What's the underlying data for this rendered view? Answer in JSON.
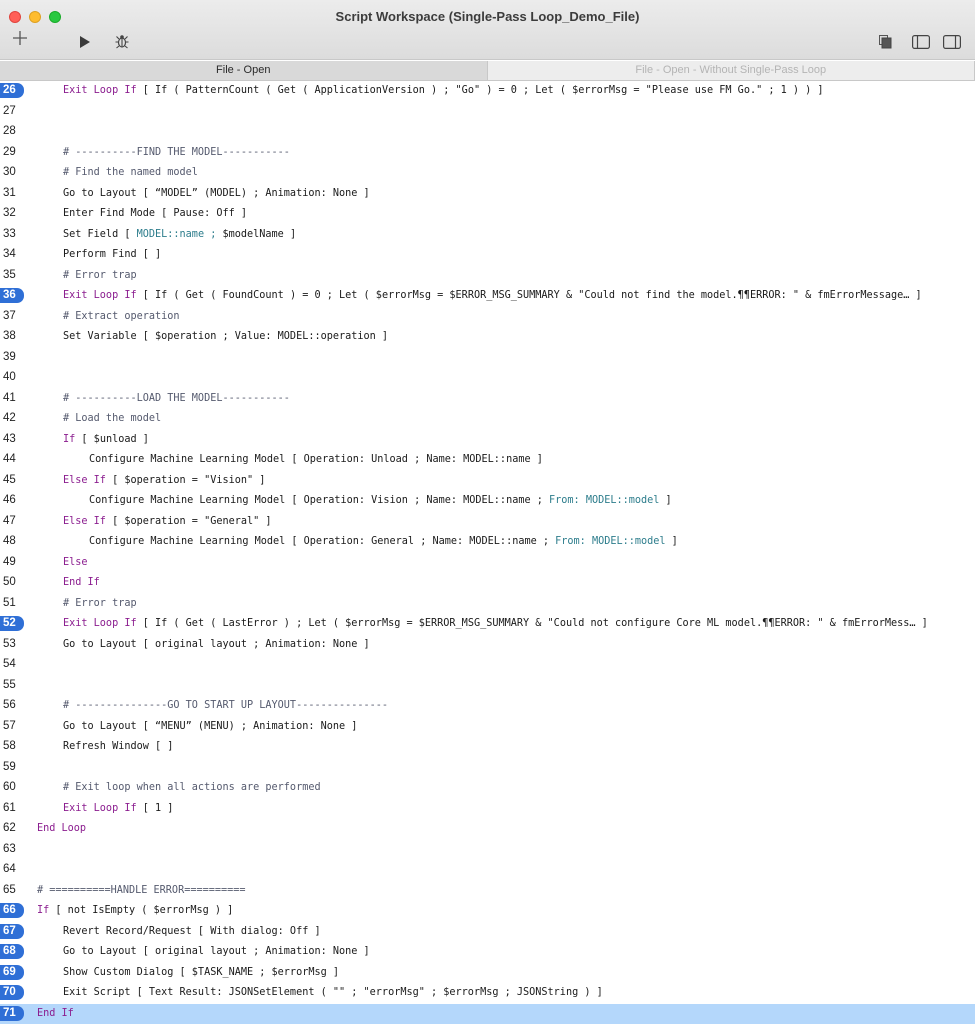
{
  "window": {
    "title": "Script Workspace (Single-Pass Loop_Demo_File)"
  },
  "toolbar": {
    "icons": [
      "plus-icon",
      "play-icon",
      "debug-bug-icon",
      "copy-pages-icon",
      "sidebar-left-icon",
      "sidebar-right-icon"
    ]
  },
  "tabs": [
    {
      "label": "File - Open",
      "active": true
    },
    {
      "label": "File - Open - Without Single-Pass Loop",
      "active": false
    }
  ],
  "colors": {
    "breakpoint": "#2f6fd6",
    "selection": "#b4d7fb",
    "keyword": "#8b1d8f",
    "field": "#2d7d8c"
  },
  "lines": [
    {
      "n": "26",
      "bp": true,
      "indent": 1,
      "parts": [
        [
          "kw",
          "Exit Loop If"
        ],
        [
          "t",
          " [ If ( PatternCount ( Get ( ApplicationVersion ) ; \"Go\" ) = 0 ; Let ( $errorMsg = \"Please use FM Go.\" ; 1 ) ) ]"
        ]
      ]
    },
    {
      "n": "27",
      "bp": false,
      "indent": 1,
      "parts": []
    },
    {
      "n": "28",
      "bp": false,
      "indent": 1,
      "parts": []
    },
    {
      "n": "29",
      "bp": false,
      "indent": 1,
      "parts": [
        [
          "cm",
          "# ----------FIND THE MODEL-----------"
        ]
      ]
    },
    {
      "n": "30",
      "bp": false,
      "indent": 1,
      "parts": [
        [
          "cm",
          "# Find the named model"
        ]
      ]
    },
    {
      "n": "31",
      "bp": false,
      "indent": 1,
      "parts": [
        [
          "t",
          "Go to Layout [ “MODEL” (MODEL) ; Animation: None ]"
        ]
      ]
    },
    {
      "n": "32",
      "bp": false,
      "indent": 1,
      "parts": [
        [
          "t",
          "Enter Find Mode [ Pause: Off ]"
        ]
      ]
    },
    {
      "n": "33",
      "bp": false,
      "indent": 1,
      "parts": [
        [
          "t",
          "Set Field [ "
        ],
        [
          "fl",
          "MODEL::name ; "
        ],
        [
          "t",
          "$modelName ]"
        ]
      ]
    },
    {
      "n": "34",
      "bp": false,
      "indent": 1,
      "parts": [
        [
          "t",
          "Perform Find [ ]"
        ]
      ]
    },
    {
      "n": "35",
      "bp": false,
      "indent": 1,
      "parts": [
        [
          "cm",
          "# Error trap"
        ]
      ]
    },
    {
      "n": "36",
      "bp": true,
      "indent": 1,
      "parts": [
        [
          "kw",
          "Exit Loop If"
        ],
        [
          "t",
          " [ If ( Get ( FoundCount ) = 0 ; Let ( $errorMsg = $ERROR_MSG_SUMMARY & \"Could not find the model.¶¶ERROR: \" & fmErrorMessage… ]"
        ]
      ]
    },
    {
      "n": "37",
      "bp": false,
      "indent": 1,
      "parts": [
        [
          "cm",
          "# Extract operation"
        ]
      ]
    },
    {
      "n": "38",
      "bp": false,
      "indent": 1,
      "parts": [
        [
          "t",
          "Set Variable [ $operation ; Value: MODEL::operation ]"
        ]
      ]
    },
    {
      "n": "39",
      "bp": false,
      "indent": 1,
      "parts": []
    },
    {
      "n": "40",
      "bp": false,
      "indent": 1,
      "parts": []
    },
    {
      "n": "41",
      "bp": false,
      "indent": 1,
      "parts": [
        [
          "cm",
          "# ----------LOAD THE MODEL-----------"
        ]
      ]
    },
    {
      "n": "42",
      "bp": false,
      "indent": 1,
      "parts": [
        [
          "cm",
          "# Load the model"
        ]
      ]
    },
    {
      "n": "43",
      "bp": false,
      "indent": 1,
      "parts": [
        [
          "kw",
          "If"
        ],
        [
          "t",
          " [ $unload ]"
        ]
      ]
    },
    {
      "n": "44",
      "bp": false,
      "indent": 2,
      "parts": [
        [
          "t",
          "Configure Machine Learning Model [ Operation: Unload ; Name: MODEL::name ]"
        ]
      ]
    },
    {
      "n": "45",
      "bp": false,
      "indent": 1,
      "parts": [
        [
          "kw",
          "Else If"
        ],
        [
          "t",
          " [ $operation = \"Vision\" ]"
        ]
      ]
    },
    {
      "n": "46",
      "bp": false,
      "indent": 2,
      "parts": [
        [
          "t",
          "Configure Machine Learning Model [ Operation: Vision ; Name: MODEL::name ; "
        ],
        [
          "fl",
          "From: MODEL::model"
        ],
        [
          "t",
          " ]"
        ]
      ]
    },
    {
      "n": "47",
      "bp": false,
      "indent": 1,
      "parts": [
        [
          "kw",
          "Else If"
        ],
        [
          "t",
          " [ $operation = \"General\" ]"
        ]
      ]
    },
    {
      "n": "48",
      "bp": false,
      "indent": 2,
      "parts": [
        [
          "t",
          "Configure Machine Learning Model [ Operation: General ; Name: MODEL::name ; "
        ],
        [
          "fl",
          "From: MODEL::model"
        ],
        [
          "t",
          " ]"
        ]
      ]
    },
    {
      "n": "49",
      "bp": false,
      "indent": 1,
      "parts": [
        [
          "kw",
          "Else"
        ]
      ]
    },
    {
      "n": "50",
      "bp": false,
      "indent": 1,
      "parts": [
        [
          "kw",
          "End If"
        ]
      ]
    },
    {
      "n": "51",
      "bp": false,
      "indent": 1,
      "parts": [
        [
          "cm",
          "# Error trap"
        ]
      ]
    },
    {
      "n": "52",
      "bp": true,
      "indent": 1,
      "parts": [
        [
          "kw",
          "Exit Loop If"
        ],
        [
          "t",
          " [ If ( Get ( LastError ) ; Let ( $errorMsg = $ERROR_MSG_SUMMARY & \"Could not configure Core ML model.¶¶ERROR: \" & fmErrorMess… ]"
        ]
      ]
    },
    {
      "n": "53",
      "bp": false,
      "indent": 1,
      "parts": [
        [
          "t",
          "Go to Layout [ original layout ; Animation: None ]"
        ]
      ]
    },
    {
      "n": "54",
      "bp": false,
      "indent": 1,
      "parts": []
    },
    {
      "n": "55",
      "bp": false,
      "indent": 1,
      "parts": []
    },
    {
      "n": "56",
      "bp": false,
      "indent": 1,
      "parts": [
        [
          "cm",
          "# ---------------GO TO START UP LAYOUT---------------"
        ]
      ]
    },
    {
      "n": "57",
      "bp": false,
      "indent": 1,
      "parts": [
        [
          "t",
          "Go to Layout [ “MENU” (MENU) ; Animation: None ]"
        ]
      ]
    },
    {
      "n": "58",
      "bp": false,
      "indent": 1,
      "parts": [
        [
          "t",
          "Refresh Window [ ]"
        ]
      ]
    },
    {
      "n": "59",
      "bp": false,
      "indent": 1,
      "parts": []
    },
    {
      "n": "60",
      "bp": false,
      "indent": 1,
      "parts": [
        [
          "cm",
          "# Exit loop when all actions are performed"
        ]
      ]
    },
    {
      "n": "61",
      "bp": false,
      "indent": 1,
      "parts": [
        [
          "kw",
          "Exit Loop If"
        ],
        [
          "t",
          " [ 1 ]"
        ]
      ]
    },
    {
      "n": "62",
      "bp": false,
      "indent": 0,
      "parts": [
        [
          "kw",
          "End Loop"
        ]
      ]
    },
    {
      "n": "63",
      "bp": false,
      "indent": 0,
      "parts": []
    },
    {
      "n": "64",
      "bp": false,
      "indent": 0,
      "parts": []
    },
    {
      "n": "65",
      "bp": false,
      "indent": 0,
      "parts": [
        [
          "cm",
          "# ==========HANDLE ERROR=========="
        ]
      ]
    },
    {
      "n": "66",
      "bp": true,
      "indent": 0,
      "parts": [
        [
          "kw",
          "If"
        ],
        [
          "t",
          " [ not IsEmpty ( $errorMsg ) ]"
        ]
      ]
    },
    {
      "n": "67",
      "bp": true,
      "indent": 1,
      "parts": [
        [
          "t",
          "Revert Record/Request [ With dialog: Off ]"
        ]
      ]
    },
    {
      "n": "68",
      "bp": true,
      "indent": 1,
      "parts": [
        [
          "t",
          "Go to Layout [ original layout ; Animation: None ]"
        ]
      ]
    },
    {
      "n": "69",
      "bp": true,
      "indent": 1,
      "parts": [
        [
          "t",
          "Show Custom Dialog [ $TASK_NAME ; $errorMsg ]"
        ]
      ]
    },
    {
      "n": "70",
      "bp": true,
      "indent": 1,
      "parts": [
        [
          "t",
          "Exit Script [ Text Result: JSONSetElement ( \"\" ; \"errorMsg\" ; $errorMsg ; JSONString ) ]"
        ]
      ]
    },
    {
      "n": "71",
      "bp": true,
      "indent": 0,
      "selected": true,
      "parts": [
        [
          "kw",
          "End If"
        ]
      ]
    }
  ]
}
